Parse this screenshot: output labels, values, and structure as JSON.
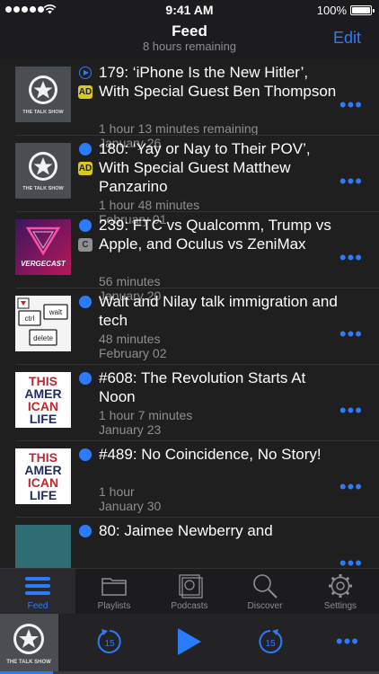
{
  "status_bar": {
    "time": "9:41 AM",
    "battery": "100%"
  },
  "nav": {
    "title": "Feed",
    "subtitle": "8 hours remaining",
    "edit_label": "Edit"
  },
  "episodes": [
    {
      "title": "179: ‘iPhone Is the New Hitler’, With Special Guest Ben Thompson",
      "duration": "1 hour 13 minutes remaining",
      "date": "January 26",
      "tag": "AD",
      "status": "playing",
      "artwork": "the-talk-show"
    },
    {
      "title": "180: ‘Yay or Nay to Their POV’, With Special Guest Matthew Panzarino",
      "duration": "1 hour 48 minutes",
      "date": "February 01",
      "tag": "AD",
      "status": "unplayed",
      "artwork": "the-talk-show"
    },
    {
      "title": "239: FTC vs Qualcomm, Trump vs Apple, and Oculus vs ZeniMax",
      "duration": "56 minutes",
      "date": "January 20",
      "tag": "C",
      "status": "unplayed",
      "artwork": "vergecast"
    },
    {
      "title": "Walt and Nilay talk immigration and tech",
      "duration": "48 minutes",
      "date": "February 02",
      "tag": "",
      "status": "unplayed",
      "artwork": "ctrl-walt-delete"
    },
    {
      "title": "#608: The Revolution Starts At Noon",
      "duration": "1 hour 7 minutes",
      "date": "January 23",
      "tag": "",
      "status": "unplayed",
      "artwork": "this-american-life"
    },
    {
      "title": "#489: No Coincidence, No Story!",
      "duration": "1 hour",
      "date": "January 30",
      "tag": "",
      "status": "unplayed",
      "artwork": "this-american-life"
    },
    {
      "title": "80: Jaimee Newberry and",
      "duration": "",
      "date": "",
      "tag": "",
      "status": "unplayed",
      "artwork": "teal"
    }
  ],
  "artwork_text": {
    "talk_show": "THE TALK SHOW",
    "vergecast": "VERGECAST",
    "ctrl": "ctrl",
    "walt": "walt",
    "delete": "delete",
    "tal": [
      "THIS",
      "AMER",
      "ICAN",
      "LIFE"
    ]
  },
  "tabs": [
    {
      "label": "Feed",
      "icon": "feed-list-icon",
      "active": true
    },
    {
      "label": "Playlists",
      "icon": "folder-icon",
      "active": false
    },
    {
      "label": "Podcasts",
      "icon": "podcasts-grid-icon",
      "active": false
    },
    {
      "label": "Discover",
      "icon": "magnifier-icon",
      "active": false
    },
    {
      "label": "Settings",
      "icon": "gear-icon",
      "active": false
    }
  ],
  "player": {
    "skip_back_seconds": "15",
    "skip_forward_seconds": "15",
    "progress_fraction": 0.14,
    "artwork_text": "THE TALK SHOW"
  },
  "colors": {
    "accent": "#2b7bff",
    "background": "#1c1c1e",
    "ad_tag": "#d8c926",
    "tal_red": "#c0282d",
    "tal_navy": "#1d2d5e"
  }
}
